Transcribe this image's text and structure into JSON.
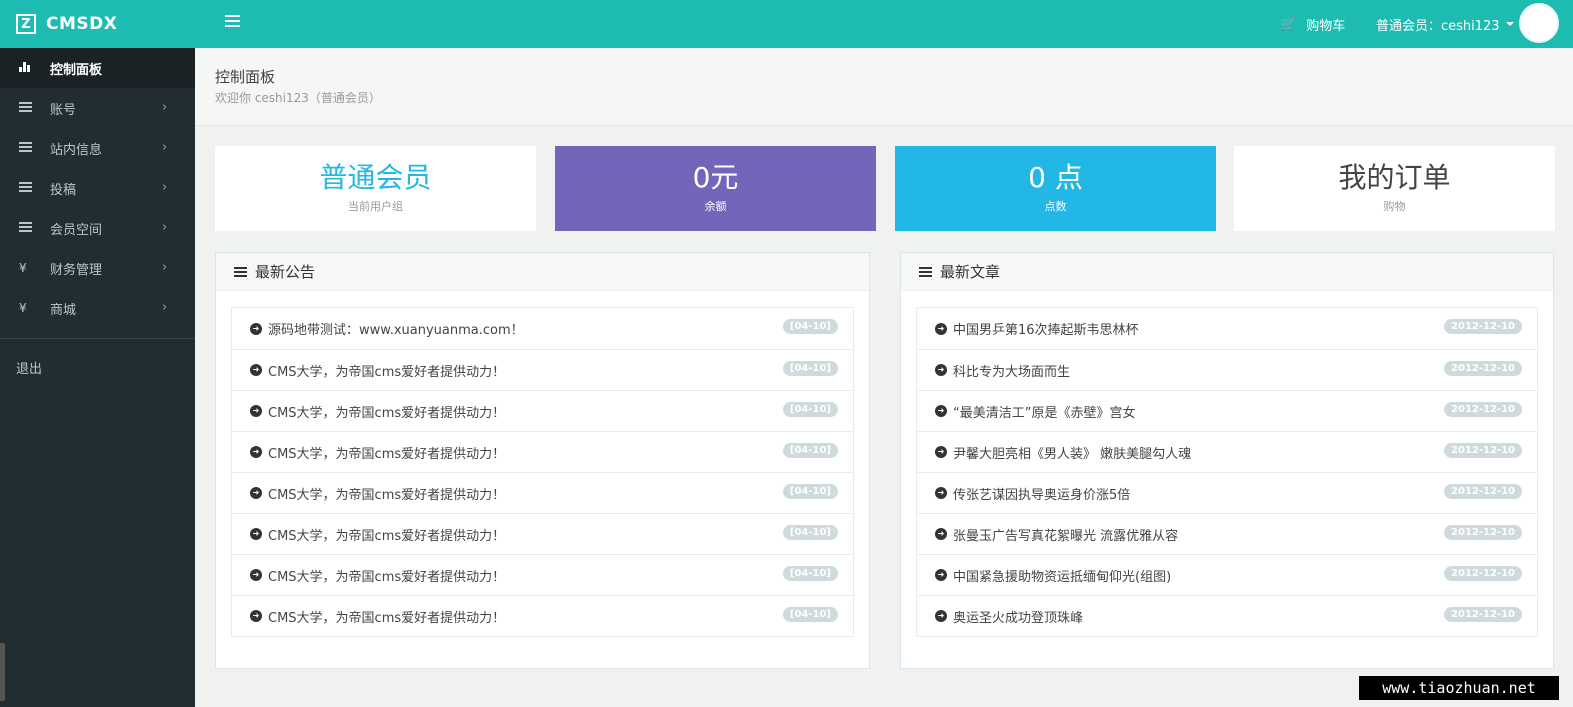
{
  "header": {
    "logo_letter": "Z",
    "brand": "CMSDX",
    "cart_label": "购物车",
    "user_label": "普通会员：ceshi123"
  },
  "sidebar": {
    "items": [
      {
        "label": "控制面板",
        "icon": "bar-chart-icon",
        "active": true
      },
      {
        "label": "账号",
        "icon": "list-icon"
      },
      {
        "label": "站内信息",
        "icon": "list-icon"
      },
      {
        "label": "投稿",
        "icon": "list-icon"
      },
      {
        "label": "会员空间",
        "icon": "list-icon"
      },
      {
        "label": "财务管理",
        "icon": "yen-icon"
      },
      {
        "label": "商城",
        "icon": "yen-icon"
      }
    ],
    "yen": "¥",
    "chevron": "›",
    "logout": "退出"
  },
  "page": {
    "title": "控制面板",
    "subtitle": "欢迎你 ceshi123（普通会员）"
  },
  "stats": [
    {
      "value": "普通会员",
      "label": "当前用户组"
    },
    {
      "value": "0元",
      "label": "余额"
    },
    {
      "value": "0 点",
      "label": "点数"
    },
    {
      "value": "我的订单",
      "label": "购物"
    }
  ],
  "announcements": {
    "title": "最新公告",
    "items": [
      {
        "title": "源码地带测试：www.xuanyuanma.com！",
        "date": "[04-10]"
      },
      {
        "title": "CMS大学，为帝国cms爱好者提供动力！",
        "date": "[04-10]"
      },
      {
        "title": "CMS大学，为帝国cms爱好者提供动力！",
        "date": "[04-10]"
      },
      {
        "title": "CMS大学，为帝国cms爱好者提供动力！",
        "date": "[04-10]"
      },
      {
        "title": "CMS大学，为帝国cms爱好者提供动力！",
        "date": "[04-10]"
      },
      {
        "title": "CMS大学，为帝国cms爱好者提供动力！",
        "date": "[04-10]"
      },
      {
        "title": "CMS大学，为帝国cms爱好者提供动力！",
        "date": "[04-10]"
      },
      {
        "title": "CMS大学，为帝国cms爱好者提供动力！",
        "date": "[04-10]"
      }
    ]
  },
  "articles": {
    "title": "最新文章",
    "items": [
      {
        "title": "中国男乒第16次捧起斯韦思林杯",
        "date": "2012-12-10"
      },
      {
        "title": "科比专为大场面而生",
        "date": "2012-12-10"
      },
      {
        "title": "“最美清洁工”原是《赤壁》宫女",
        "date": "2012-12-10"
      },
      {
        "title": "尹馨大胆亮相《男人装》 嫩肤美腿勾人魂",
        "date": "2012-12-10"
      },
      {
        "title": "传张艺谋因执导奥运身价涨5倍",
        "date": "2012-12-10"
      },
      {
        "title": "张曼玉广告写真花絮曝光 流露优雅从容",
        "date": "2012-12-10"
      },
      {
        "title": "中国紧急援助物资运抵缅甸仰光(组图)",
        "date": "2012-12-10"
      },
      {
        "title": "奥运圣火成功登顶珠峰",
        "date": "2012-12-10"
      }
    ]
  },
  "watermark": "www.tiaozhuan.net"
}
